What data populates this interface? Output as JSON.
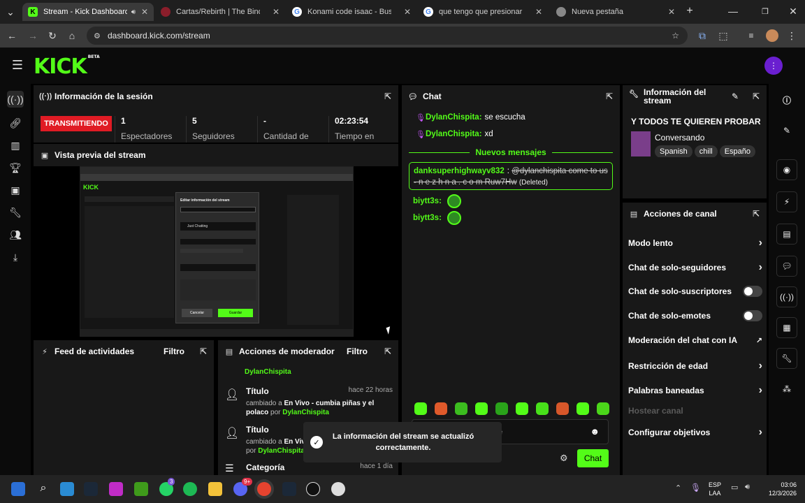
{
  "browser": {
    "tabs": [
      {
        "title": "Stream - Kick Dashboard",
        "favicon": "K",
        "color": "#53fc18"
      },
      {
        "title": "Cartas/Rebirth | The Binding of",
        "favicon": "",
        "color": "#8b1e2b"
      },
      {
        "title": "Konami code isaac - Buscar con",
        "favicon": "G",
        "color": "#ffffff"
      },
      {
        "title": "que tengo que presionar para",
        "favicon": "G",
        "color": "#ffffff"
      },
      {
        "title": "Nueva pestaña",
        "favicon": "",
        "color": "#888888"
      }
    ],
    "url": "dashboard.kick.com/stream"
  },
  "kick": {
    "logo": "KICK",
    "logo_tag": "BETA",
    "accent": "#53fc18"
  },
  "session": {
    "title": "Información de la sesión",
    "status": "TRANSMITIENDO",
    "stats": [
      {
        "value": "1",
        "label": "Espectadores"
      },
      {
        "value": "5",
        "label": "Seguidores"
      },
      {
        "value": "-",
        "label": "Cantidad de"
      },
      {
        "value": "02:23:54",
        "label": "Tiempo en"
      }
    ]
  },
  "preview": {
    "title": "Vista previa del stream",
    "modal_title": "Editar información del stream",
    "modal_category": "Just Chatting",
    "modal_cancel": "Cancelar",
    "modal_save": "Guardar"
  },
  "feed": {
    "title": "Feed de actividades",
    "filter": "Filtro"
  },
  "modactions": {
    "title": "Acciones de moderador",
    "filter": "Filtro",
    "top_user": "DylanChispita",
    "entries": [
      {
        "title": "Título",
        "when": "hace 22 horas",
        "verb": "cambiado a",
        "value": "En Vivo - cumbia piñas y el polaco",
        "by": "por",
        "user": "DylanChispita"
      },
      {
        "title": "Título",
        "when": "",
        "verb": "cambiado a",
        "value": "En Vivo",
        "by": "por",
        "user": "DylanChispita"
      },
      {
        "title": "Categoría",
        "when": "hace 1 día",
        "verb": "",
        "value": "",
        "by": "",
        "user": ""
      }
    ]
  },
  "chat": {
    "title": "Chat",
    "messages": [
      {
        "user": "DylanChispita",
        "text": "se escucha"
      },
      {
        "user": "DylanChispita",
        "text": "xd"
      }
    ],
    "new_messages": "Nuevos mensajes",
    "highlight_user": "danksuperhighwayv832",
    "highlight_text": "@dylanchispita come to us - n e z h n a . c o m Ruw7Hw",
    "deleted": "(Deleted)",
    "emote_user": "biytt3s",
    "input_placeholder": "je",
    "send": "Chat"
  },
  "toast": {
    "text": "La información del stream se actualizó correctamente."
  },
  "streaminfo": {
    "title": "Información del stream",
    "stream_title": "Y TODOS TE QUIEREN PROBAR",
    "category": "Conversando",
    "tags": [
      "Spanish",
      "chill",
      "Españo"
    ]
  },
  "channel": {
    "title": "Acciones de canal",
    "items": [
      {
        "label": "Modo lento",
        "control": "chevron"
      },
      {
        "label": "Chat de solo-seguidores",
        "control": "chevron"
      },
      {
        "label": "Chat de solo-suscriptores",
        "control": "toggle"
      },
      {
        "label": "Chat de solo-emotes",
        "control": "toggle"
      },
      {
        "label": "Moderación del chat con IA",
        "control": "external"
      },
      {
        "label": "Restricción de edad",
        "control": "chevron"
      },
      {
        "label": "Palabras baneadas",
        "control": "chevron"
      },
      {
        "label": "Hostear canal",
        "control": "disabled"
      },
      {
        "label": "Configurar objetivos",
        "control": "chevron"
      }
    ]
  },
  "taskbar": {
    "lang": "ESP",
    "region": "LAA",
    "time": "03:06",
    "date": "12/3/2026",
    "whatsapp_badge": "3",
    "discord_badge": "9+"
  }
}
